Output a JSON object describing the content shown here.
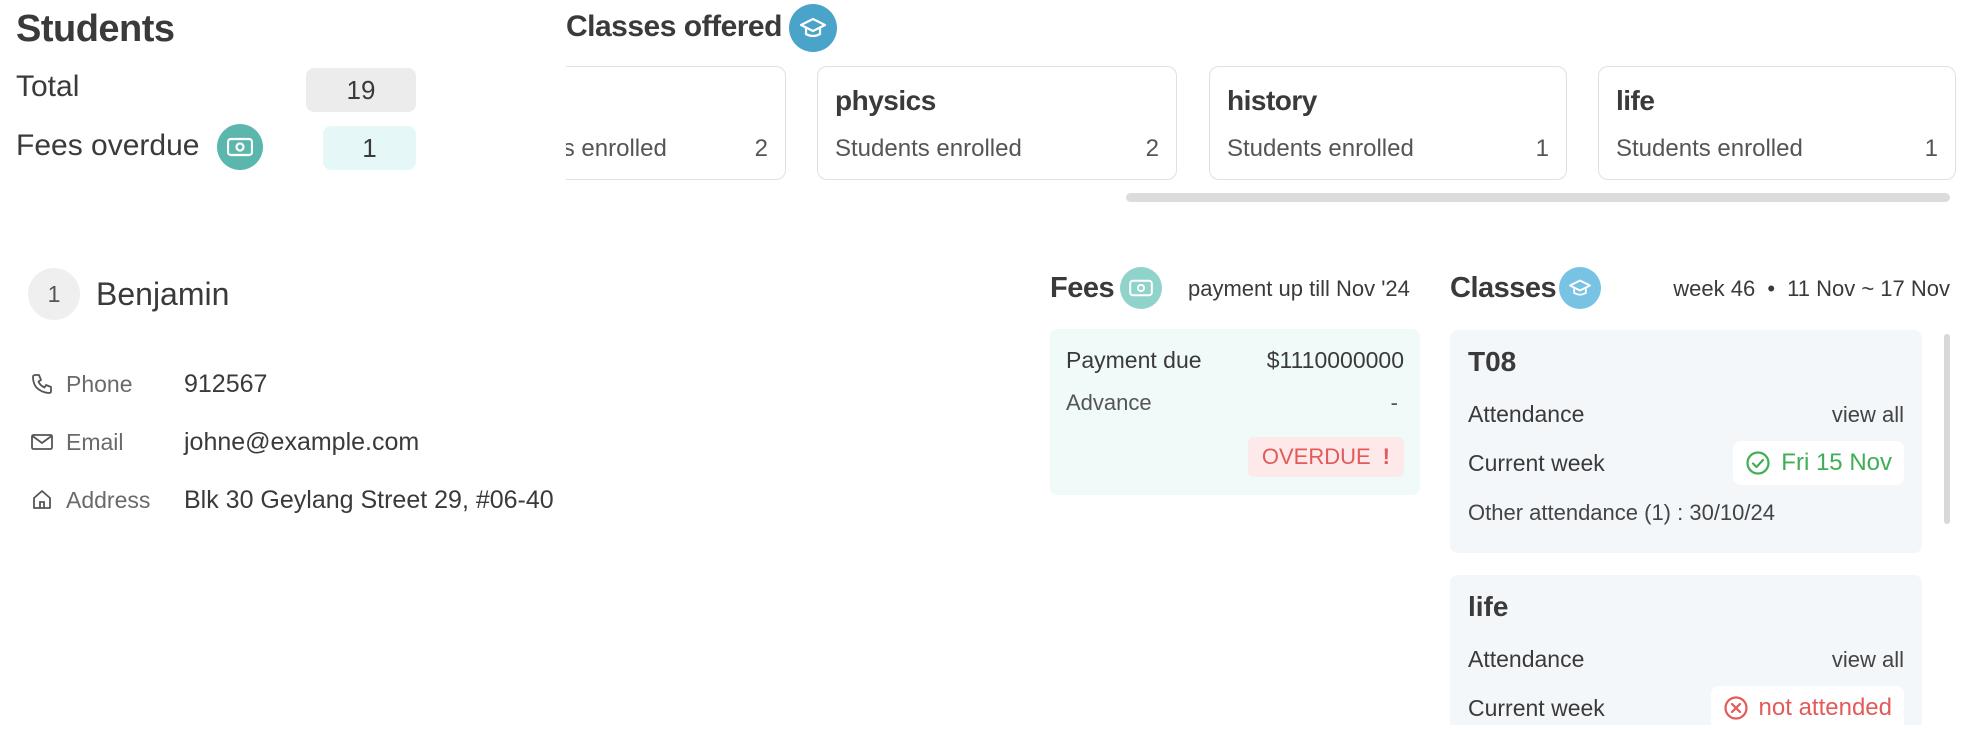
{
  "students": {
    "title": "Students",
    "total_label": "Total",
    "total_value": "19",
    "overdue_label": "Fees overdue",
    "overdue_value": "1"
  },
  "classes_offered": {
    "title": "Classes offered",
    "cards": [
      {
        "name": "",
        "label": "Students enrolled",
        "count": "2"
      },
      {
        "name": "physics",
        "label": "Students enrolled",
        "count": "2"
      },
      {
        "name": "history",
        "label": "Students enrolled",
        "count": "1"
      },
      {
        "name": "life",
        "label": "Students enrolled",
        "count": "1"
      }
    ]
  },
  "student": {
    "index": "1",
    "name": "Benjamin",
    "phone_label": "Phone",
    "phone": "912567",
    "email_label": "Email",
    "email": "johne@example.com",
    "address_label": "Address",
    "address": "Blk 30 Geylang Street 29, #06-40"
  },
  "fees": {
    "title": "Fees",
    "period": "payment up till Nov '24",
    "payment_due_label": "Payment due",
    "payment_due": "$1110000000",
    "advance_label": "Advance",
    "advance": "-",
    "status": "OVERDUE",
    "status_mark": "!"
  },
  "classes": {
    "title": "Classes",
    "week": "week 46",
    "range": "11 Nov ~ 17 Nov",
    "items": [
      {
        "name": "T08",
        "attendance_label": "Attendance",
        "view_all": "view all",
        "current_week_label": "Current week",
        "current_status": "Fri 15 Nov",
        "other": "Other attendance (1) : 30/10/24"
      },
      {
        "name": "life",
        "attendance_label": "Attendance",
        "view_all": "view all",
        "current_week_label": "Current week",
        "current_status": "not attended"
      }
    ]
  },
  "colors": {
    "teal": "#5bb7ad",
    "blue": "#4aa3c8",
    "light_blue": "#78c3e3",
    "green": "#3fae55",
    "red": "#e25a5a"
  }
}
